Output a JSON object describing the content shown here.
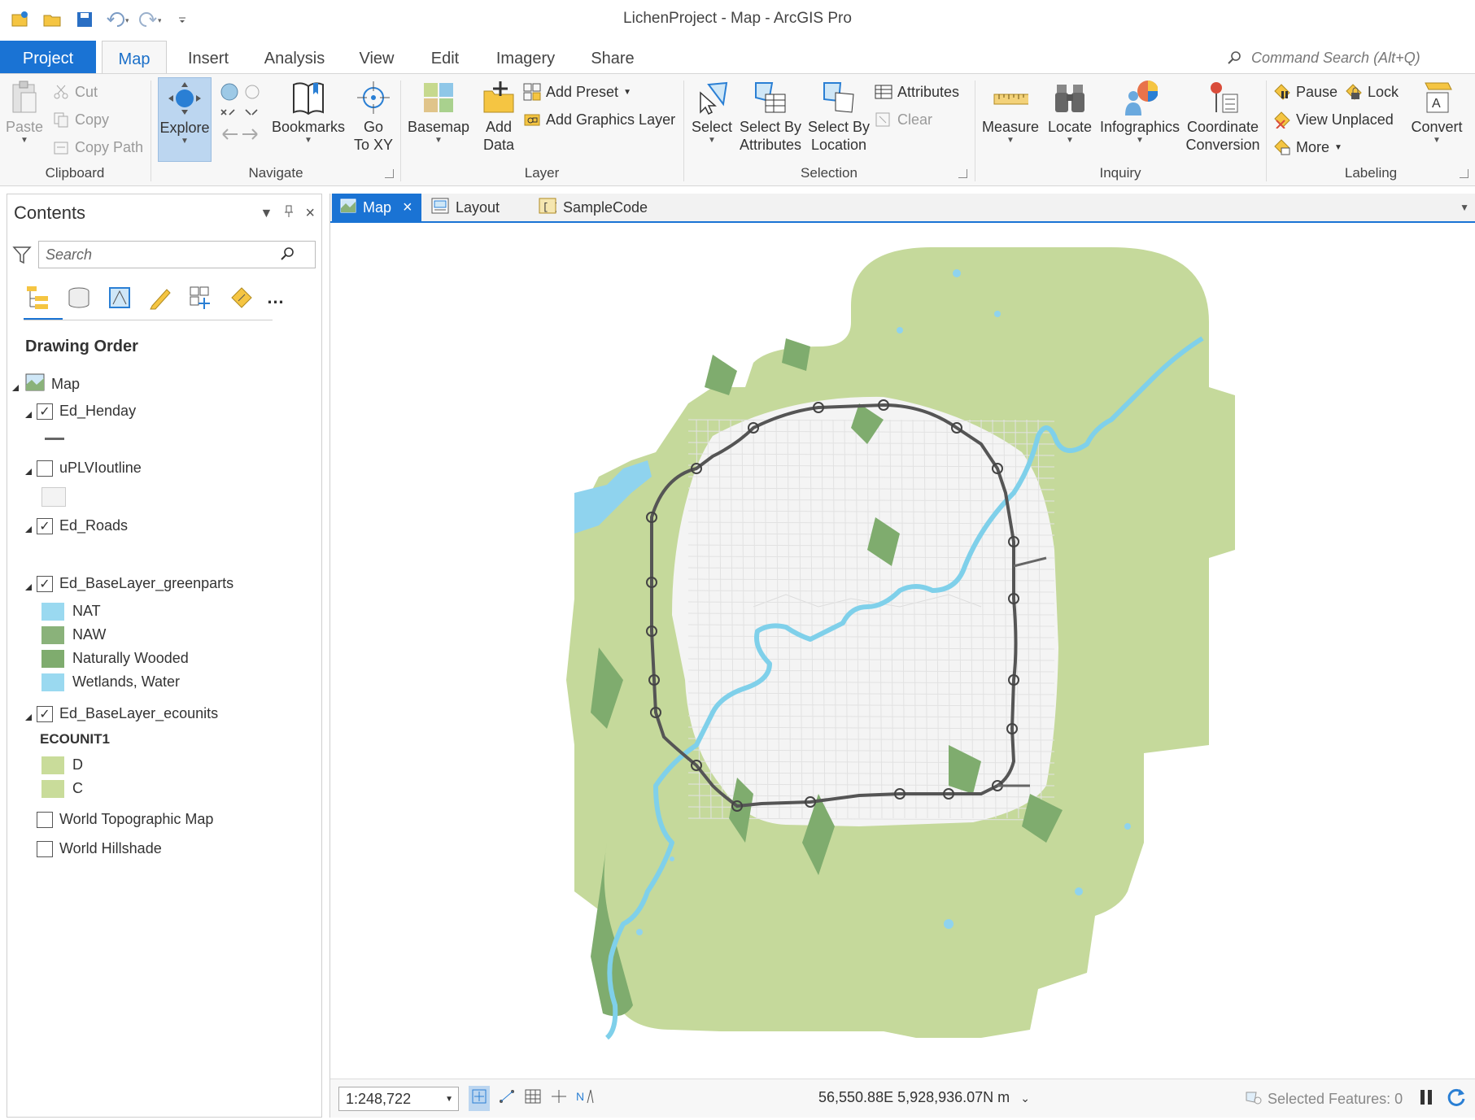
{
  "app": {
    "title": "LichenProject - Map - ArcGIS Pro"
  },
  "ribbon_tabs": [
    "Project",
    "Map",
    "Insert",
    "Analysis",
    "View",
    "Edit",
    "Imagery",
    "Share"
  ],
  "command_search": {
    "placeholder": "Command Search (Alt+Q)"
  },
  "clipboard": {
    "paste": "Paste",
    "cut": "Cut",
    "copy": "Copy",
    "copy_path": "Copy Path",
    "label": "Clipboard"
  },
  "navigate": {
    "explore": "Explore",
    "bookmarks": "Bookmarks",
    "go_to_xy_line1": "Go",
    "go_to_xy_line2": "To XY",
    "label": "Navigate"
  },
  "layer": {
    "basemap": "Basemap",
    "add_data_line1": "Add",
    "add_data_line2": "Data",
    "add_preset": "Add Preset",
    "add_graphics_layer": "Add Graphics Layer",
    "label": "Layer"
  },
  "selection": {
    "select": "Select",
    "select_by_attr_line1": "Select By",
    "select_by_attr_line2": "Attributes",
    "select_by_loc_line1": "Select By",
    "select_by_loc_line2": "Location",
    "attributes": "Attributes",
    "clear": "Clear",
    "label": "Selection"
  },
  "inquiry": {
    "measure": "Measure",
    "locate": "Locate",
    "infographics": "Infographics",
    "coord_line1": "Coordinate",
    "coord_line2": "Conversion",
    "label": "Inquiry"
  },
  "labeling": {
    "pause": "Pause",
    "lock": "Lock",
    "view_unplaced": "View Unplaced",
    "more": "More",
    "convert": "Convert",
    "label": "Labeling"
  },
  "contents": {
    "title": "Contents",
    "search_placeholder": "Search",
    "drawing_order": "Drawing Order",
    "map_name": "Map",
    "layers": {
      "henday": "Ed_Henday",
      "uplvi": "uPLVIoutline",
      "roads": "Ed_Roads",
      "greenparts": "Ed_BaseLayer_greenparts",
      "ecounits": "Ed_BaseLayer_ecounits",
      "topo": "World Topographic Map",
      "hillshade": "World Hillshade"
    },
    "greenparts_classes": [
      {
        "label": "NAT",
        "color": "#9ad9f0"
      },
      {
        "label": "NAW",
        "color": "#8ab27a"
      },
      {
        "label": "Naturally Wooded",
        "color": "#7fac6e"
      },
      {
        "label": "Wetlands, Water",
        "color": "#9ad9f0"
      }
    ],
    "ecounit_field": "ECOUNIT1",
    "ecounit_classes": [
      {
        "label": "D",
        "color": "#c9dc9a"
      },
      {
        "label": "C",
        "color": "#c9dc9a"
      }
    ]
  },
  "view_tabs": {
    "map": "Map",
    "layout": "Layout",
    "code": "SampleCode"
  },
  "status": {
    "scale": "1:248,722",
    "coords": "56,550.88E 5,928,936.07N m",
    "selected_features": "Selected Features: 0"
  },
  "colors": {
    "accent": "#1a73d4",
    "green_area": "#c5d99b",
    "wooded": "#7fac6e",
    "water": "#7fd0ea",
    "ring_road": "#555555"
  }
}
